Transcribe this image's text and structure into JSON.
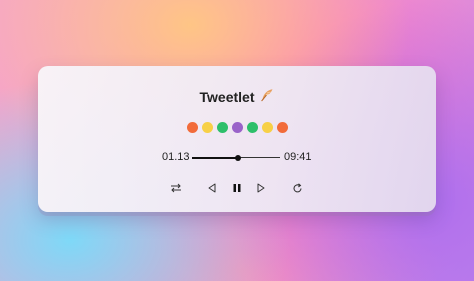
{
  "player": {
    "title": "Tweetlet",
    "title_icon": "feather-icon",
    "swatches": [
      "#f26b3a",
      "#f7d046",
      "#2dbf6a",
      "#9a63c9",
      "#2dbf6a",
      "#f7d046",
      "#f26b3a"
    ],
    "current_time": "01.13",
    "total_time": "09:41",
    "progress": 0.52,
    "controls": {
      "shuffle_icon": "shuffle-icon",
      "previous_icon": "previous-icon",
      "pause_icon": "pause-icon",
      "next_icon": "next-icon",
      "repeat_icon": "repeat-icon"
    }
  }
}
